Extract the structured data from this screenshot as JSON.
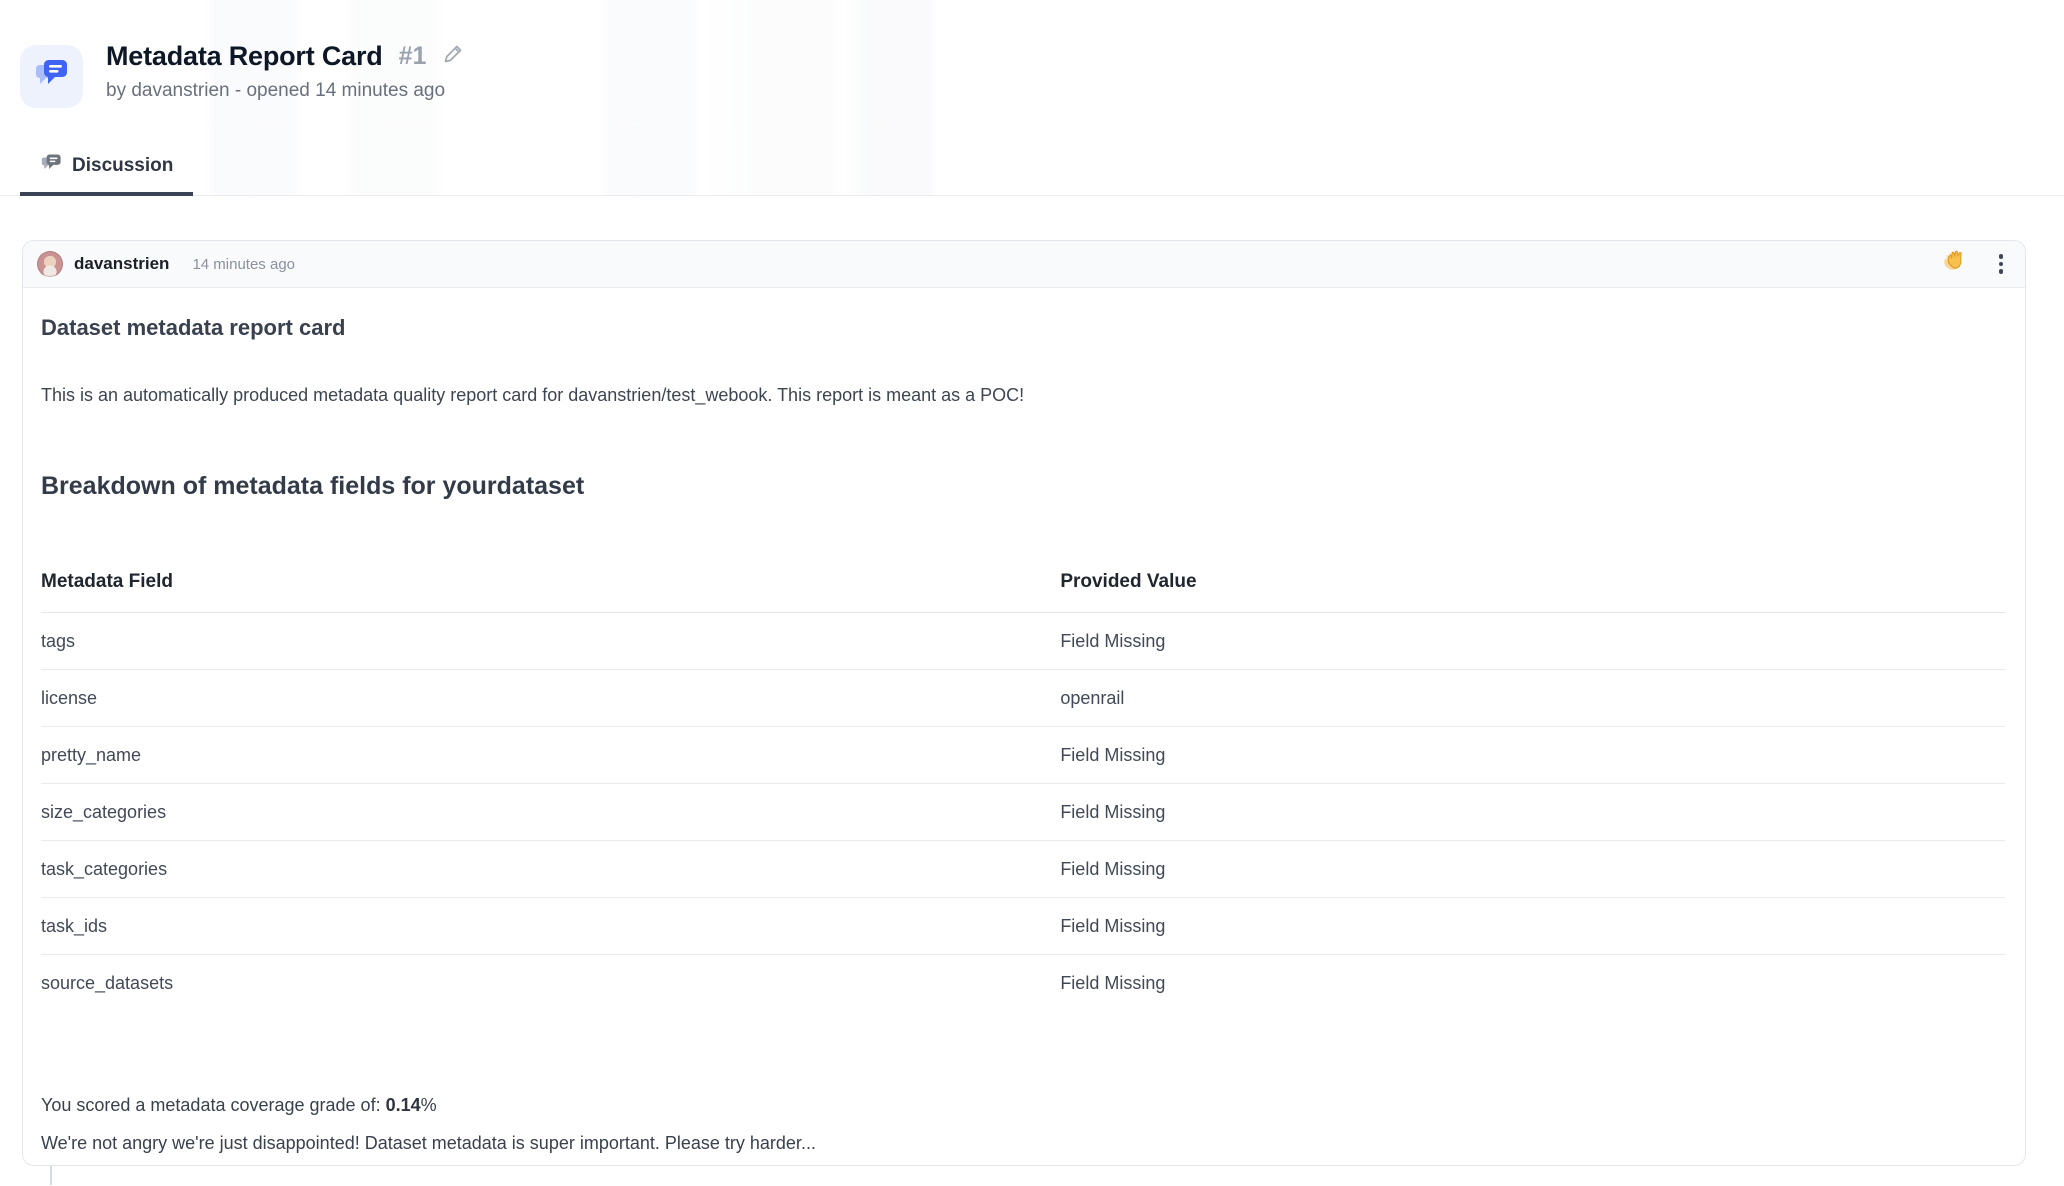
{
  "header": {
    "title": "Metadata Report Card",
    "issue_number": "#1",
    "byline": "by davanstrien - opened 14 minutes ago",
    "tab_label": "Discussion"
  },
  "comment": {
    "author": "davanstrien",
    "timestamp": "14 minutes ago",
    "heading": "Dataset metadata report card",
    "intro": "This is an automatically produced metadata quality report card for davanstrien/test_webook. This report is meant as a POC!",
    "section_heading": "Breakdown of metadata fields for yourdataset",
    "table": {
      "columns": [
        "Metadata Field",
        "Provided Value"
      ],
      "rows": [
        [
          "tags",
          "Field Missing"
        ],
        [
          "license",
          "openrail"
        ],
        [
          "pretty_name",
          "Field Missing"
        ],
        [
          "size_categories",
          "Field Missing"
        ],
        [
          "task_categories",
          "Field Missing"
        ],
        [
          "task_ids",
          "Field Missing"
        ],
        [
          "source_datasets",
          "Field Missing"
        ]
      ]
    },
    "grade_prefix": "You scored a metadata coverage grade of: ",
    "grade_value": "0.14",
    "grade_suffix": "%",
    "closing": "We're not angry we're just disappointed! Dataset metadata is super important. Please try harder...",
    "reaction": "waving-hand"
  },
  "colors": {
    "accent_blue": "#3f63f2",
    "accent_blue_light": "#aabefa",
    "tab_underline": "#3a4354",
    "reaction_hand": "#f6c14d"
  }
}
